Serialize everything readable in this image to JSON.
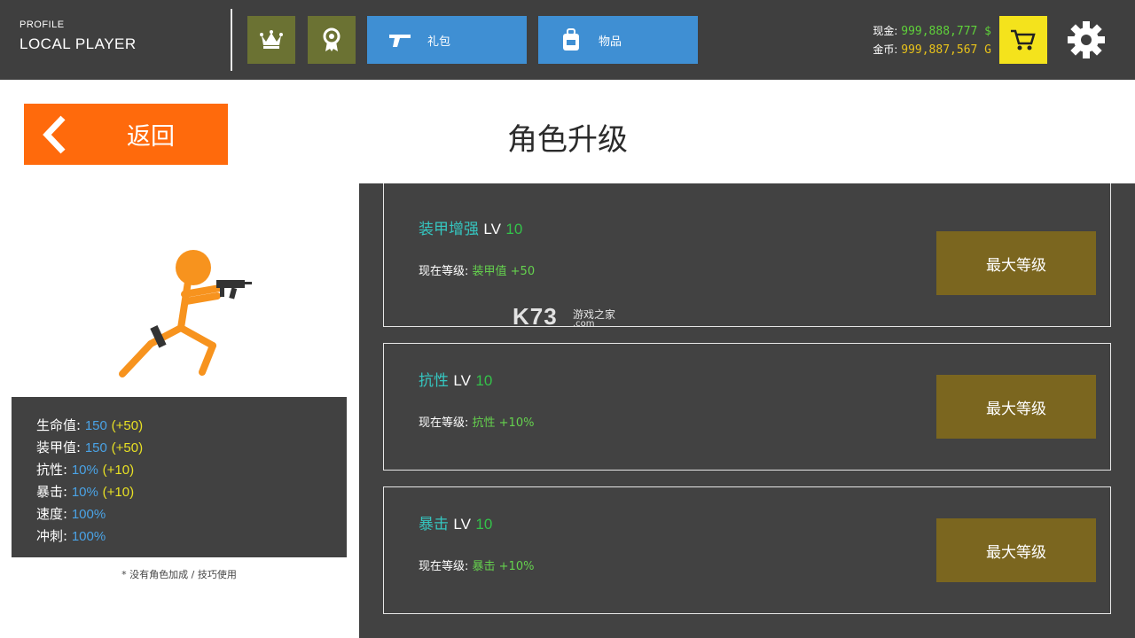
{
  "header": {
    "profile_label": "PROFILE",
    "player_name": "LOCAL PLAYER",
    "gift_label": "礼包",
    "items_label": "物品",
    "cash_label": "现金:",
    "cash_value": "999,888,777 $",
    "gold_label": "金币:",
    "gold_value": "999,887,567 G"
  },
  "back": {
    "label": "返回"
  },
  "page_title": "角色升级",
  "stats": {
    "rows": [
      {
        "label": "生命值:",
        "value": "150",
        "bonus": "(+50)"
      },
      {
        "label": "装甲值:",
        "value": "150",
        "bonus": "(+50)"
      },
      {
        "label": "抗性:",
        "value": "10%",
        "bonus": "(+10)"
      },
      {
        "label": "暴击:",
        "value": "10%",
        "bonus": "(+10)"
      },
      {
        "label": "速度:",
        "value": "100%",
        "bonus": ""
      },
      {
        "label": "冲刺:",
        "value": "100%",
        "bonus": ""
      }
    ],
    "note": "* 没有角色加成 / 技巧使用"
  },
  "upgrades": [
    {
      "name": "装甲增强",
      "lv": "LV",
      "level": "10",
      "current_label": "现在等级:",
      "current_value": "装甲值 +50",
      "button": "最大等级"
    },
    {
      "name": "抗性",
      "lv": "LV",
      "level": "10",
      "current_label": "现在等级:",
      "current_value": "抗性 +10%",
      "button": "最大等级"
    },
    {
      "name": "暴击",
      "lv": "LV",
      "level": "10",
      "current_label": "现在等级:",
      "current_value": "暴击 +10%",
      "button": "最大等级"
    }
  ],
  "watermark": {
    "brand": "K73",
    "text": "游戏之家",
    "domain": ".com"
  },
  "colors": {
    "topbar": "#3f3f3f",
    "back_button": "#ff6a0c",
    "max_button": "#7b661f",
    "blue_button": "#3f8fd3",
    "olive_button": "#6b7233",
    "cart_button": "#f4e31c",
    "character": "#f7931e"
  },
  "icons": [
    "crown-icon",
    "medal-icon",
    "pistol-icon",
    "backpack-icon",
    "cart-icon",
    "gear-icon",
    "chevron-left-icon"
  ]
}
